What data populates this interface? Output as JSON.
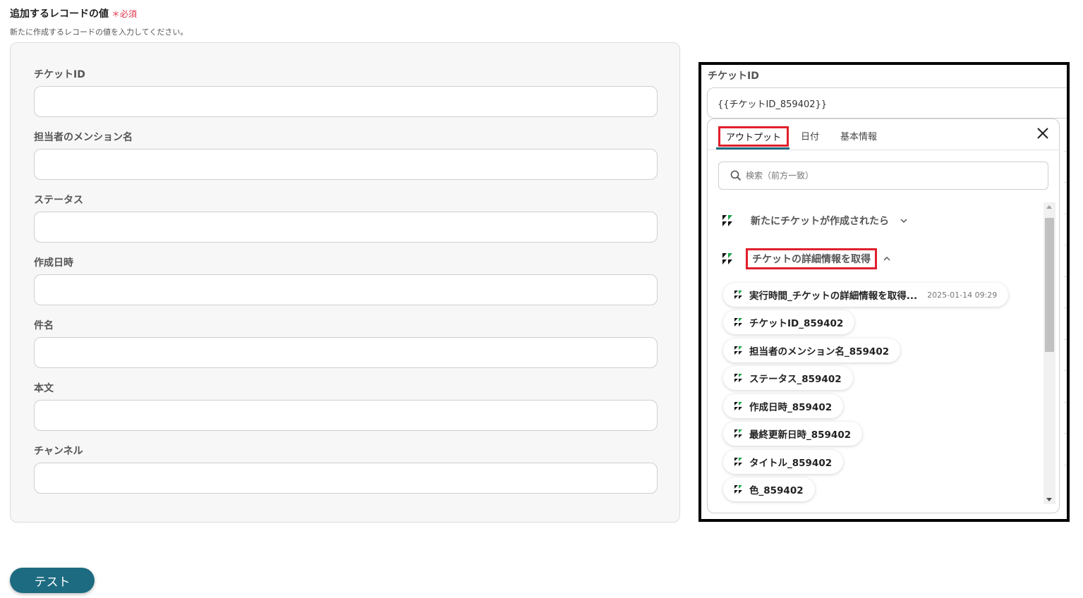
{
  "section": {
    "title": "追加するレコードの値",
    "required_label": "＊必須",
    "description": "新たに作成するレコードの値を入力してください。"
  },
  "form_fields": [
    {
      "label": "チケットID",
      "value": ""
    },
    {
      "label": "担当者のメンション名",
      "value": ""
    },
    {
      "label": "ステータス",
      "value": ""
    },
    {
      "label": "作成日時",
      "value": ""
    },
    {
      "label": "件名",
      "value": ""
    },
    {
      "label": "本文",
      "value": ""
    },
    {
      "label": "チャンネル",
      "value": ""
    }
  ],
  "test_button_label": "テスト",
  "callout": {
    "field_label": "チケットID",
    "field_value": "{{チケットID_859402}}",
    "tabs": [
      "アウトプット",
      "日付",
      "基本情報"
    ],
    "active_tab": "アウトプット",
    "close_icon": "close-icon",
    "search_placeholder": "検索（前方一致）",
    "groups": [
      {
        "label": "新たにチケットが作成されたら",
        "expanded": false
      },
      {
        "label": "チケットの詳細情報を取得",
        "expanded": true
      }
    ],
    "items": [
      {
        "label": "実行時間_チケットの詳細情報を取得...",
        "value": "2025-01-14 09:29"
      },
      {
        "label": "チケットID_859402",
        "value": ""
      },
      {
        "label": "担当者のメンション名_859402",
        "value": ""
      },
      {
        "label": "ステータス_859402",
        "value": ""
      },
      {
        "label": "作成日時_859402",
        "value": ""
      },
      {
        "label": "最終更新日時_859402",
        "value": ""
      },
      {
        "label": "タイトル_859402",
        "value": ""
      },
      {
        "label": "色_859402",
        "value": ""
      }
    ]
  },
  "colors": {
    "accent": "#1d6b80",
    "required": "#e0344a",
    "highlight_box": "#e0202c"
  }
}
